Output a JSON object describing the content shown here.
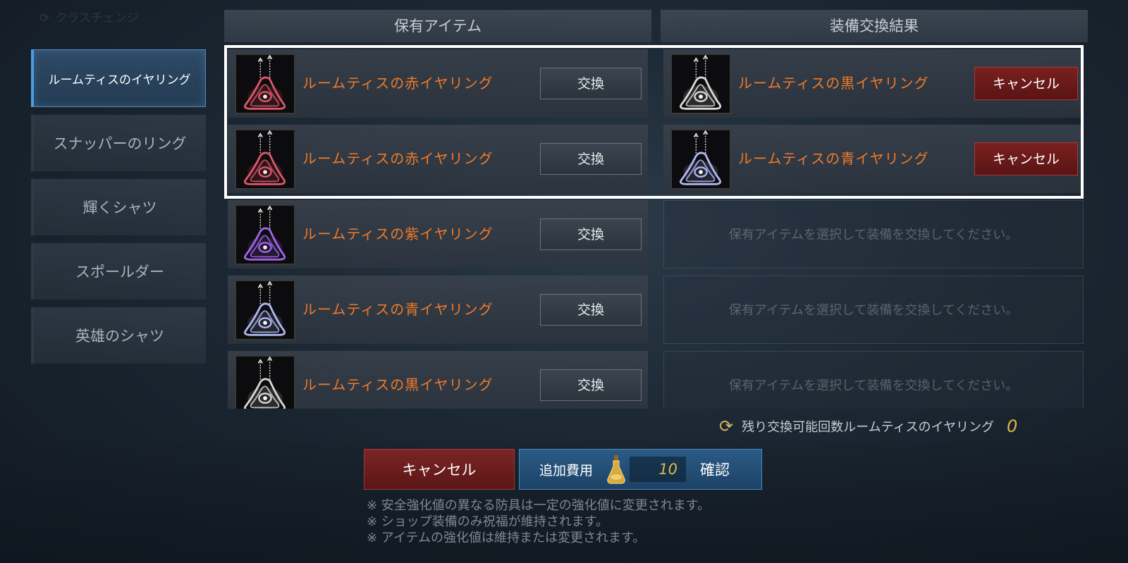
{
  "header": {
    "class_change": "クラスチェンジ",
    "held_items": "保有アイテム",
    "exchange_result": "装備交換結果"
  },
  "sidebar": {
    "items": [
      {
        "label": "ルームティスのイヤリング",
        "active": true
      },
      {
        "label": "スナッパーのリング",
        "active": false
      },
      {
        "label": "輝くシャツ",
        "active": false
      },
      {
        "label": "スポールダー",
        "active": false
      },
      {
        "label": "英雄のシャツ",
        "active": false
      }
    ]
  },
  "held_items": [
    {
      "name": "ルームティスの赤イヤリング",
      "button": "交換",
      "color": "#e0556a"
    },
    {
      "name": "ルームティスの赤イヤリング",
      "button": "交換",
      "color": "#e0556a"
    },
    {
      "name": "ルームティスの紫イヤリング",
      "button": "交換",
      "color": "#a064e8"
    },
    {
      "name": "ルームティスの青イヤリング",
      "button": "交換",
      "color": "#aeb8f0"
    },
    {
      "name": "ルームティスの黒イヤリング",
      "button": "交換",
      "color": "#d8d8d8"
    }
  ],
  "results": [
    {
      "name": "ルームティスの黒イヤリング",
      "button": "キャンセル",
      "color": "#d8d8d8"
    },
    {
      "name": "ルームティスの青イヤリング",
      "button": "キャンセル",
      "color": "#aeb8f0"
    },
    {
      "placeholder": "保有アイテムを選択して装備を交換してください。"
    },
    {
      "placeholder": "保有アイテムを選択して装備を交換してください。"
    },
    {
      "placeholder": "保有アイテムを選択して装備を交換してください。"
    }
  ],
  "remaining": {
    "label": "残り交換可能回数ルームティスのイヤリング",
    "count": "0"
  },
  "footer": {
    "cancel": "キャンセル",
    "extra_cost_label": "追加費用",
    "extra_cost_value": "10",
    "confirm": "確認",
    "notes": [
      "※ 安全強化値の異なる防具は一定の強化値に変更されます。",
      "※ ショップ装備のみ祝福が維持されます。",
      "※ アイテムの強化値は維持または変更されます。"
    ]
  },
  "colors": {
    "item_name": "#f07a2a",
    "accent_blue": "#4a9de0",
    "cancel_red": "#7a1f1f",
    "count_gold": "#e0b64a"
  }
}
